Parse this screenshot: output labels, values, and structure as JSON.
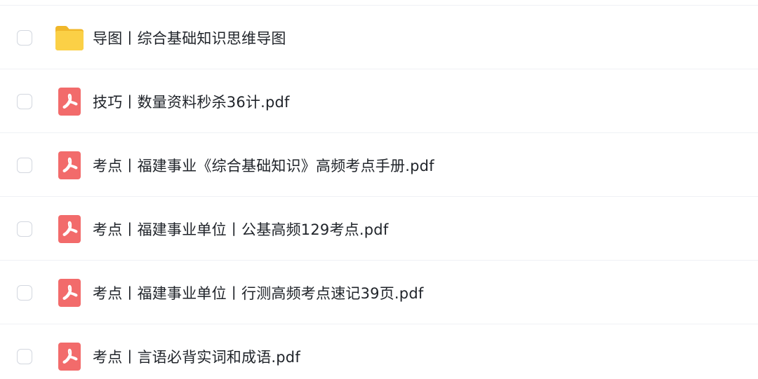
{
  "file_list": {
    "items": [
      {
        "name": "导图丨综合基础知识思维导图",
        "icon": "folder-icon",
        "checked": false
      },
      {
        "name": "技巧丨数量资料秒杀36计.pdf",
        "icon": "pdf-icon",
        "checked": false
      },
      {
        "name": "考点丨福建事业《综合基础知识》高频考点手册.pdf",
        "icon": "pdf-icon",
        "checked": false
      },
      {
        "name": "考点丨福建事业单位丨公基高频129考点.pdf",
        "icon": "pdf-icon",
        "checked": false
      },
      {
        "name": "考点丨福建事业单位丨行测高频考点速记39页.pdf",
        "icon": "pdf-icon",
        "checked": false
      },
      {
        "name": "考点丨言语必背实词和成语.pdf",
        "icon": "pdf-icon",
        "checked": false
      }
    ]
  },
  "colors": {
    "folder": "#f7c832",
    "pdf": "#f26b6b",
    "text": "#1f2329",
    "divider": "#eff1f5",
    "checkbox_border": "#d3d7df"
  }
}
